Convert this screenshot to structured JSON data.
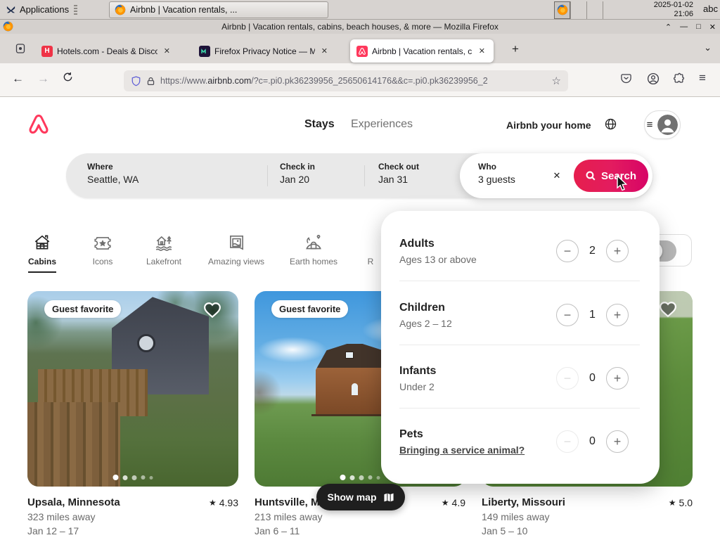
{
  "os": {
    "applications_label": "Applications",
    "task_button_label": "Airbnb | Vacation rentals, ...",
    "clock_date": "2025-01-02",
    "clock_time": "21:06",
    "kbd_layout": "abc"
  },
  "window": {
    "title": "Airbnb | Vacation rentals, cabins, beach houses, & more — Mozilla Firefox"
  },
  "browser": {
    "tabs": [
      {
        "label": "Hotels.com - Deals & Disco"
      },
      {
        "label": "Firefox Privacy Notice — M"
      },
      {
        "label": "Airbnb | Vacation rentals, c"
      }
    ],
    "url_prefix": "https://www.",
    "url_domain": "airbnb.com",
    "url_path": "/?c=.pi0.pk36239956_25650614176&&c=.pi0.pk36239956_2"
  },
  "icons": {
    "window_shade": "⌃",
    "window_min": "—",
    "window_max": "□",
    "window_close": "✕",
    "tab_close": "✕",
    "new_tab": "+",
    "all_tabs": "⌄",
    "back": "←",
    "forward": "→",
    "bookmark_star": "☆",
    "hamburger": "≡",
    "menu": "≡",
    "clear": "✕",
    "minus": "−",
    "plus": "+",
    "rating_star": "★",
    "hotels_letter": "H"
  },
  "header": {
    "stays": "Stays",
    "experiences": "Experiences",
    "host_link": "Airbnb your home"
  },
  "search": {
    "where_label": "Where",
    "where_value": "Seattle, WA",
    "checkin_label": "Check in",
    "checkin_value": "Jan 20",
    "checkout_label": "Check out",
    "checkout_value": "Jan 31",
    "who_label": "Who",
    "who_value": "3 guests",
    "button_label": "Search"
  },
  "categories": [
    {
      "label": "Cabins"
    },
    {
      "label": "Icons"
    },
    {
      "label": "Lakefront"
    },
    {
      "label": "Amazing views"
    },
    {
      "label": "Earth homes"
    },
    {
      "label": "R"
    }
  ],
  "guest_picker": {
    "rows": [
      {
        "title": "Adults",
        "subtitle": "Ages 13 or above",
        "value": "2"
      },
      {
        "title": "Children",
        "subtitle": "Ages 2 – 12",
        "value": "1"
      },
      {
        "title": "Infants",
        "subtitle": "Under 2",
        "value": "0"
      },
      {
        "title": "Pets",
        "subtitle": "Bringing a service animal?",
        "value": "0"
      }
    ]
  },
  "listings": [
    {
      "badge": "Guest favorite",
      "title": "Upsala, Minnesota",
      "rating": "4.93",
      "distance": "323 miles away",
      "dates": "Jan 12 – 17"
    },
    {
      "badge": "Guest favorite",
      "title": "Huntsville, M",
      "rating": "4.9",
      "distance": "213 miles away",
      "dates": "Jan 6 – 11"
    },
    {
      "title": "Liberty, Missouri",
      "rating": "5.0",
      "distance": "149 miles away",
      "dates": "Jan 5 – 10"
    }
  ],
  "map_button_label": "Show map",
  "colors": {
    "accent": "#FF385C",
    "search_gradient": [
      "#E61E4D",
      "#E31C5F",
      "#D70466"
    ],
    "dark_pill": "#1F1F1F"
  }
}
